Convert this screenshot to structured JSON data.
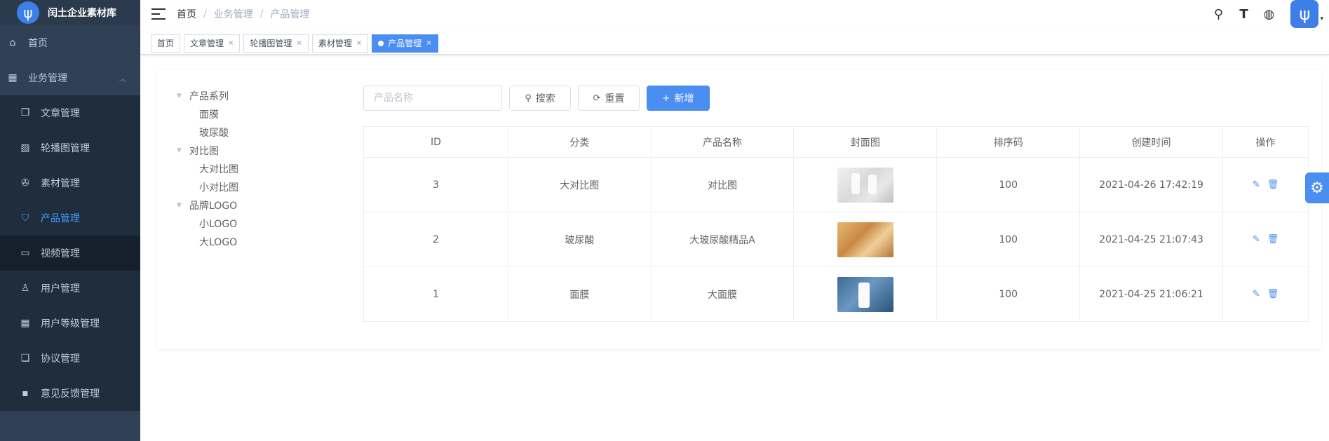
{
  "app": {
    "title": "闰土企业素材库",
    "logo_glyph": "ψ"
  },
  "sidebar": {
    "items": [
      {
        "label": "首页",
        "icon": "home-icon",
        "glyph": "⌂",
        "type": "top"
      },
      {
        "label": "业务管理",
        "icon": "grid-icon",
        "glyph": "▦",
        "type": "top",
        "expanded": true
      },
      {
        "label": "文章管理",
        "icon": "document-icon",
        "glyph": "❐",
        "type": "sub"
      },
      {
        "label": "轮播图管理",
        "icon": "image-icon",
        "glyph": "▧",
        "type": "sub"
      },
      {
        "label": "素材管理",
        "icon": "aperture-icon",
        "glyph": "✇",
        "type": "sub"
      },
      {
        "label": "产品管理",
        "icon": "bag-icon",
        "glyph": "⛉",
        "type": "sub",
        "active": true
      },
      {
        "label": "视频管理",
        "icon": "video-icon",
        "glyph": "▭",
        "type": "sub",
        "hover": true
      },
      {
        "label": "用户管理",
        "icon": "user-icon",
        "glyph": "♙",
        "type": "sub"
      },
      {
        "label": "用户等级管理",
        "icon": "apps-icon",
        "glyph": "▦",
        "type": "sub"
      },
      {
        "label": "协议管理",
        "icon": "file-icon",
        "glyph": "❏",
        "type": "sub"
      },
      {
        "label": "意见反馈管理",
        "icon": "chat-icon",
        "glyph": "▪",
        "type": "sub"
      }
    ]
  },
  "navbar": {
    "breadcrumb": [
      "首页",
      "业务管理",
      "产品管理"
    ],
    "tools": [
      {
        "icon": "search-icon",
        "glyph": "⚲"
      },
      {
        "icon": "font-size-icon",
        "glyph": "T"
      },
      {
        "icon": "globe-icon",
        "glyph": "◍"
      }
    ],
    "avatar_glyph": "ψ",
    "caret": "▾"
  },
  "tags": [
    {
      "label": "首页",
      "closable": false
    },
    {
      "label": "文章管理",
      "closable": true
    },
    {
      "label": "轮播图管理",
      "closable": true
    },
    {
      "label": "素材管理",
      "closable": true
    },
    {
      "label": "产品管理",
      "closable": true,
      "active": true
    }
  ],
  "tree": [
    {
      "label": "产品系列",
      "level": 0
    },
    {
      "label": "面膜",
      "level": 1
    },
    {
      "label": "玻尿酸",
      "level": 1
    },
    {
      "label": "对比图",
      "level": 0
    },
    {
      "label": "大对比图",
      "level": 1
    },
    {
      "label": "小对比图",
      "level": 1
    },
    {
      "label": "品牌LOGO",
      "level": 0
    },
    {
      "label": "小LOGO",
      "level": 1
    },
    {
      "label": "大LOGO",
      "level": 1
    }
  ],
  "toolbar": {
    "search_placeholder": "产品名称",
    "search_label": "搜索",
    "reset_label": "重置",
    "add_label": "新增"
  },
  "table": {
    "columns": [
      "ID",
      "分类",
      "产品名称",
      "封面图",
      "排序码",
      "创建时间",
      "操作"
    ],
    "rows": [
      {
        "id": "3",
        "category": "大对比图",
        "name": "对比图",
        "sort": "100",
        "created": "2021-04-26 17:42:19"
      },
      {
        "id": "2",
        "category": "玻尿酸",
        "name": "大玻尿酸精品A",
        "sort": "100",
        "created": "2021-04-25 21:07:43"
      },
      {
        "id": "1",
        "category": "面膜",
        "name": "大面膜",
        "sort": "100",
        "created": "2021-04-25 21:06:21"
      }
    ]
  },
  "colors": {
    "primary": "#4b8ef1",
    "sidebar_bg": "#304156",
    "active_text": "#409eff"
  }
}
